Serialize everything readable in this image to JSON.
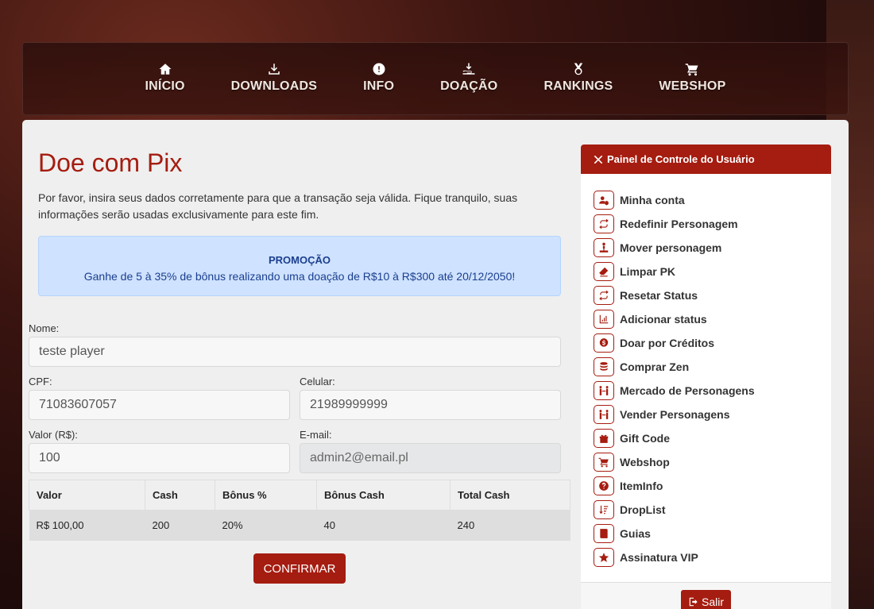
{
  "nav": {
    "items": [
      {
        "label": "INÍCIO",
        "icon": "home-icon"
      },
      {
        "label": "DOWNLOADS",
        "icon": "download-icon"
      },
      {
        "label": "INFO",
        "icon": "info-icon"
      },
      {
        "label": "DOAÇÃO",
        "icon": "donation-icon"
      },
      {
        "label": "RANKINGS",
        "icon": "medal-icon"
      },
      {
        "label": "WEBSHOP",
        "icon": "cart-icon"
      }
    ]
  },
  "main": {
    "title": "Doe com Pix",
    "description": "Por favor, insira seus dados corretamente para que a transação seja válida. Fique tranquilo, suas informações serão usadas exclusivamente para este fim.",
    "promo": {
      "title": "PROMOÇÃO",
      "text": "Ganhe de 5 à 35% de bônus realizando uma doação de R$10 à R$300 até 20/12/2050!"
    },
    "form": {
      "nome_label": "Nome:",
      "nome_value": "teste player",
      "cpf_label": "CPF:",
      "cpf_value": "71083607057",
      "celular_label": "Celular:",
      "celular_value": "21989999999",
      "valor_label": "Valor (R$):",
      "valor_value": "100",
      "email_label": "E-mail:",
      "email_value": "admin2@email.pl"
    },
    "table": {
      "headers": [
        "Valor",
        "Cash",
        "Bônus %",
        "Bônus Cash",
        "Total Cash"
      ],
      "row": [
        "R$ 100,00",
        "200",
        "20%",
        "40",
        "240"
      ]
    },
    "confirm_label": "CONFIRMAR"
  },
  "panel": {
    "title": "Painel de Controle do Usuário",
    "items": [
      {
        "label": "Minha conta",
        "icon": "user-gear-icon"
      },
      {
        "label": "Redefinir Personagem",
        "icon": "repeat-icon"
      },
      {
        "label": "Mover personagem",
        "icon": "move-icon"
      },
      {
        "label": "Limpar PK",
        "icon": "eraser-icon"
      },
      {
        "label": "Resetar Status",
        "icon": "rotate-icon"
      },
      {
        "label": "Adicionar status",
        "icon": "chart-icon"
      },
      {
        "label": "Doar por Créditos",
        "icon": "coin-icon"
      },
      {
        "label": "Comprar Zen",
        "icon": "coins-icon"
      },
      {
        "label": "Mercado de Personagens",
        "icon": "trade-icon"
      },
      {
        "label": "Vender Personagens",
        "icon": "sell-icon"
      },
      {
        "label": "Gift Code",
        "icon": "gift-icon"
      },
      {
        "label": "Webshop",
        "icon": "cart-icon"
      },
      {
        "label": "ItemInfo",
        "icon": "question-icon"
      },
      {
        "label": "DropList",
        "icon": "sort-icon"
      },
      {
        "label": "Guias",
        "icon": "book-icon"
      },
      {
        "label": "Assinatura VIP",
        "icon": "star-icon"
      }
    ],
    "logout_label": "Salir"
  },
  "colors": {
    "accent": "#a51c10",
    "promo_bg": "#cfe2ff",
    "promo_text": "#1b3f8f"
  }
}
